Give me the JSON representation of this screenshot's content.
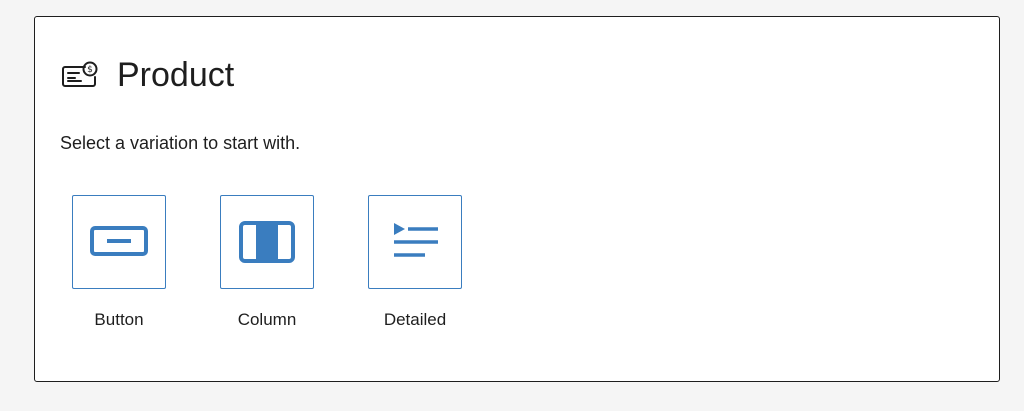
{
  "placeholder": {
    "title": "Product",
    "icon": "product-card-icon",
    "instructions": "Select a variation to start with.",
    "accent_color": "#3a7dbf",
    "variations": [
      {
        "label": "Button",
        "icon": "button-variation-icon"
      },
      {
        "label": "Column",
        "icon": "column-variation-icon"
      },
      {
        "label": "Detailed",
        "icon": "detailed-variation-icon"
      }
    ]
  }
}
